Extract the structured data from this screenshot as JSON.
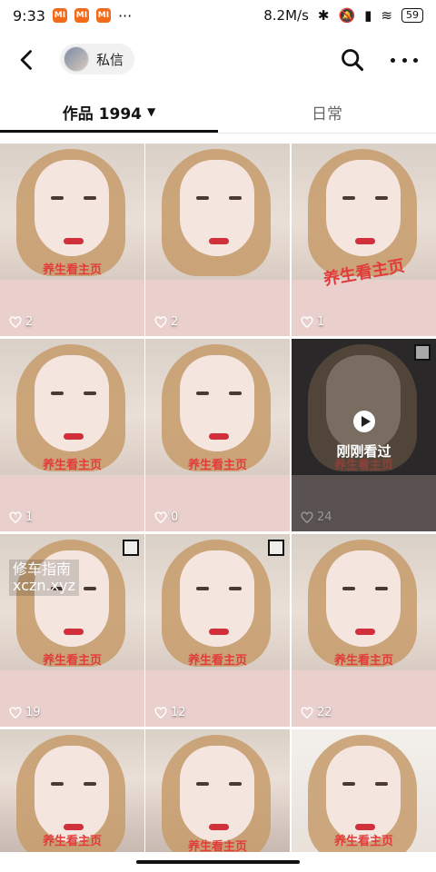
{
  "status": {
    "time": "9:33",
    "mi_badge": "MI",
    "dots": "···",
    "speed": "8.2M/s",
    "battery": "59"
  },
  "header": {
    "chip_label": "私信"
  },
  "tabs": {
    "works_label": "作品 1994",
    "daily_label": "日常"
  },
  "grid": {
    "rows": [
      [
        {
          "stamp": "养生看主页",
          "likes": "2"
        },
        {
          "stamp": "",
          "likes": "2"
        },
        {
          "stamp": "养生看主页",
          "likes": "1"
        }
      ],
      [
        {
          "stamp": "养生看主页",
          "likes": "1"
        },
        {
          "stamp": "养生看主页",
          "likes": "0"
        },
        {
          "stamp": "养生看主页",
          "likes": "24",
          "overlay": "刚刚看过"
        }
      ],
      [
        {
          "stamp": "养生看主页",
          "likes": "19",
          "watermark1": "修车指南",
          "watermark2": "xczn.xyz"
        },
        {
          "stamp": "养生看主页",
          "likes": "12"
        },
        {
          "stamp": "养生看主页",
          "likes": "22"
        }
      ],
      [
        {
          "stamp": "养生看主页"
        },
        {
          "stamp": "养生看主页"
        },
        {
          "stamp": "养生看主页"
        }
      ]
    ]
  }
}
